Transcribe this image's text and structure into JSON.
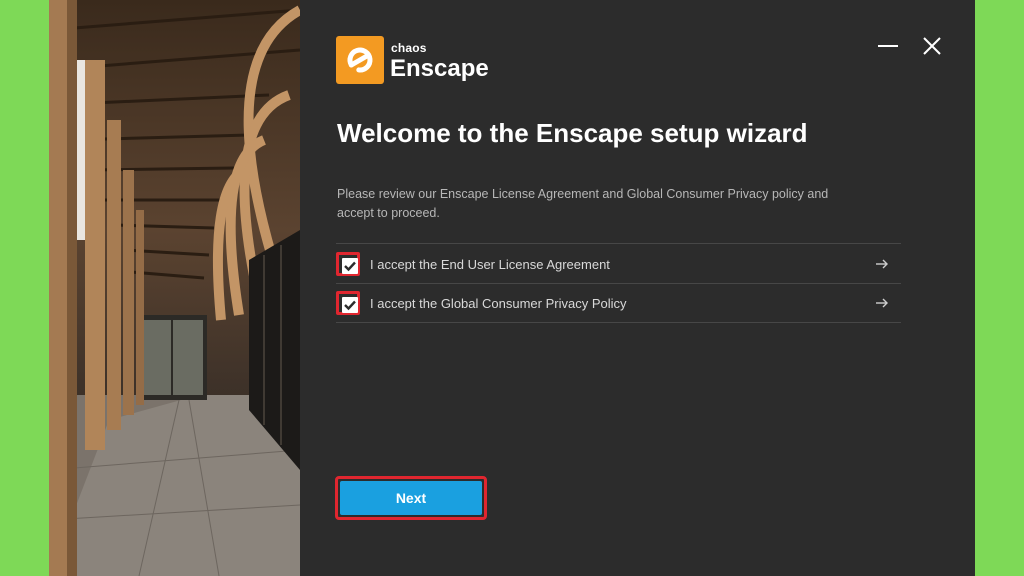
{
  "brand": {
    "company": "chaos",
    "product": "Enscape",
    "accent_color": "#f39a22"
  },
  "window_controls": {
    "minimize_icon": "minimize-icon",
    "close_icon": "close-icon"
  },
  "title": "Welcome to the Enscape setup wizard",
  "description": "Please review our Enscape License Agreement and Global Consumer Privacy policy and accept to proceed.",
  "agreements": [
    {
      "label": "I accept the End User License Agreement",
      "checked": true
    },
    {
      "label": "I accept the Global Consumer Privacy Policy",
      "checked": true
    }
  ],
  "next_button": {
    "label": "Next",
    "color": "#1aa0e0"
  },
  "highlight_color": "#e0262f",
  "background_color": "#7ed957"
}
